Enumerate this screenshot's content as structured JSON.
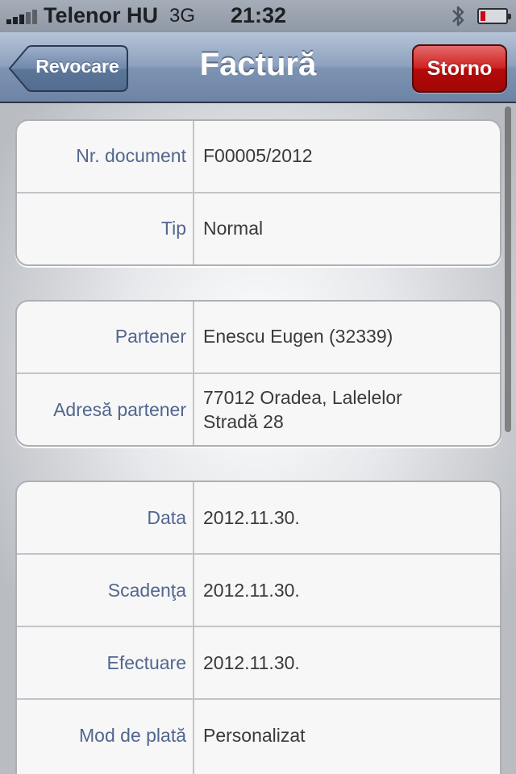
{
  "status_bar": {
    "carrier": "Telenor HU",
    "network": "3G",
    "time": "21:32"
  },
  "nav": {
    "title": "Factură",
    "back_label": "Revocare",
    "action_label": "Storno"
  },
  "groups": [
    {
      "rows": [
        {
          "label": "Nr. document",
          "value": "F00005/2012"
        },
        {
          "label": "Tip",
          "value": "Normal"
        }
      ]
    },
    {
      "rows": [
        {
          "label": "Partener",
          "value": "Enescu Eugen (32339)"
        },
        {
          "label": "Adresă partener",
          "value": "77012 Oradea, Lalelelor",
          "value2": "Stradă 28"
        }
      ]
    },
    {
      "rows": [
        {
          "label": "Data",
          "value": "2012.11.30."
        },
        {
          "label": "Scadenţa",
          "value": "2012.11.30."
        },
        {
          "label": "Efectuare",
          "value": "2012.11.30."
        },
        {
          "label": "Mod de plată",
          "value": "Personalizat"
        }
      ]
    }
  ],
  "colors": {
    "label": "#52668f",
    "value": "#3a3a3a",
    "storno": "#cf2222"
  }
}
